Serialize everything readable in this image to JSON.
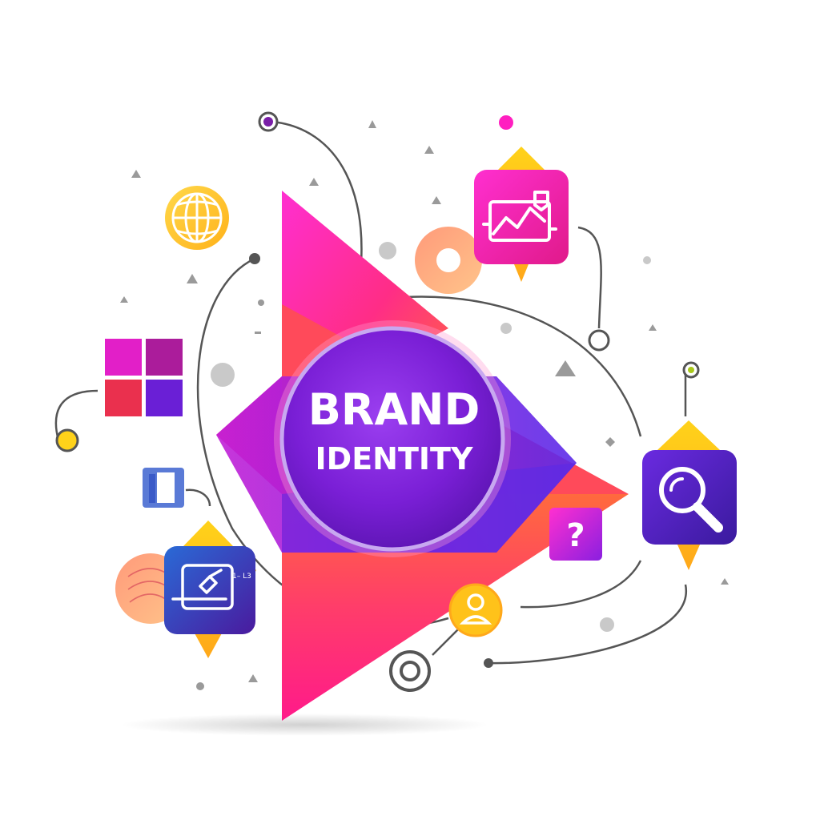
{
  "hub": {
    "line1": "BRAND",
    "line2": "IDENTITY"
  },
  "tiles": {
    "question_glyph": "?",
    "sidebar_annotation": "1– L3"
  },
  "icons": [
    "globe-icon",
    "analytics-chart-icon",
    "search-icon",
    "question-icon",
    "user-icon",
    "design-tool-icon",
    "sidebar-layout-icon",
    "color-grid-icon"
  ],
  "colors": {
    "magenta": "#ff1fa8",
    "pink": "#ff2d7a",
    "purple": "#7a1fd6",
    "deep_purple": "#4a1a9e",
    "orange": "#ff7a3a",
    "yellow": "#ffc21a",
    "blue": "#3b6cd6",
    "connector_gray": "#555555",
    "dot_gray": "#c9c9c9"
  }
}
